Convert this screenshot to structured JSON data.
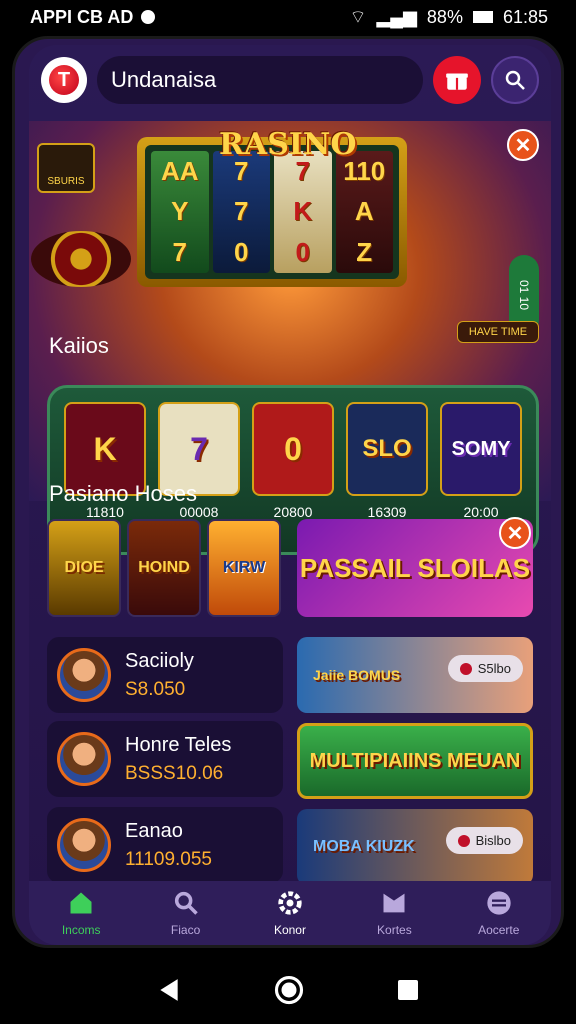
{
  "status_bar": {
    "carrier": "APPI CB AD",
    "battery": "88%",
    "time": "61:85"
  },
  "header": {
    "logo_letter": "T",
    "search_text": "Undanaisa"
  },
  "hero": {
    "sign": "RASINO",
    "badge_text": "SBURIS",
    "reels": [
      [
        "AA",
        "Y",
        "7"
      ],
      [
        "7",
        "7",
        "0"
      ],
      [
        "7",
        "K",
        "0"
      ],
      [
        "110",
        "A",
        "Z"
      ]
    ],
    "side_pill": "01 10",
    "tag": "HAVE TIME"
  },
  "featured": {
    "title": "Kaiios",
    "tiles": [
      {
        "symbol": "K",
        "value": "11810",
        "bg": "#6a0a1a"
      },
      {
        "symbol": "7",
        "value": "00008",
        "bg": "#e8e0c0"
      },
      {
        "symbol": "0",
        "value": "20800",
        "bg": "#b01a1a"
      },
      {
        "symbol": "SLO",
        "value": "16309",
        "bg": "#1a2a5a"
      },
      {
        "symbol": "SOMY",
        "value": "20:00",
        "bg": "#2a1a6a"
      }
    ]
  },
  "houses": {
    "title": "Pasiano Hoses",
    "small_tiles": [
      {
        "text": "DIOE",
        "bg": "#8a5a00"
      },
      {
        "text": "HOIND",
        "bg": "#5a1a0a"
      },
      {
        "text": "KIRW",
        "bg": "#d47a1a"
      }
    ],
    "promo_banner": "PASSAIL SLOILAS"
  },
  "players": [
    {
      "name": "Saciioly",
      "score": "S8.050"
    },
    {
      "name": "Honre Teles",
      "score": "BSSS10.06"
    },
    {
      "name": "Eanao",
      "score": "11109.055"
    }
  ],
  "promos": [
    {
      "text": "Jaiie BOMUS",
      "pill": "S5lbo",
      "bg": "#2a6ab0"
    },
    {
      "text": "MULTIPIAIINS MEUAN",
      "pill": "",
      "bg": "#2a8a3a"
    },
    {
      "text": "MOBA KIUZK",
      "pill": "Bislbo",
      "bg": "#1a3a7a"
    }
  ],
  "nav": [
    {
      "label": "Incoms",
      "icon": "home-icon",
      "active": true
    },
    {
      "label": "Fiaco",
      "icon": "search-icon",
      "active": false
    },
    {
      "label": "Konor",
      "icon": "gear-icon",
      "active": false
    },
    {
      "label": "Kortes",
      "icon": "gift-icon",
      "active": false
    },
    {
      "label": "Aocerte",
      "icon": "menu-icon",
      "active": false
    }
  ],
  "colors": {
    "accent": "#e8531a",
    "active": "#3ecf5a",
    "bg": "#2b1a55"
  }
}
